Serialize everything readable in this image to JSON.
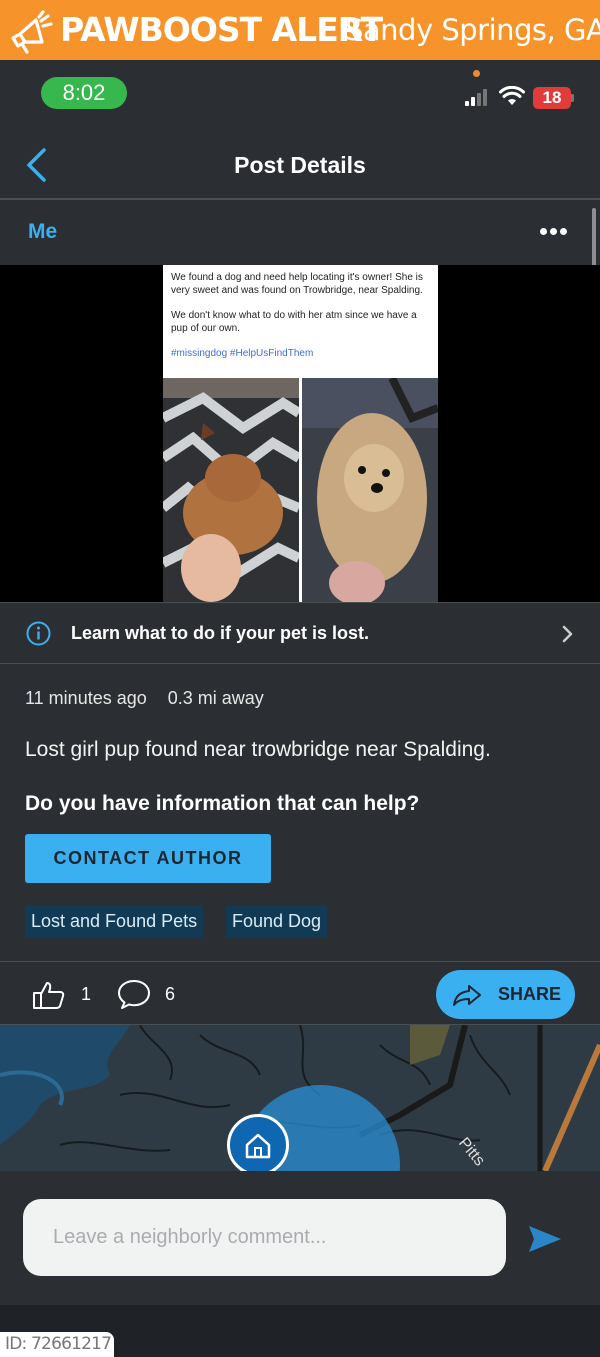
{
  "banner": {
    "title": "PAWBOOST ALERT",
    "location": "Sandy Springs, GA",
    "icon": "megaphone-icon",
    "color": "#f7932b"
  },
  "status_bar": {
    "time": "8:02",
    "battery": "18"
  },
  "header": {
    "title": "Post Details",
    "back_icon": "chevron-left-icon"
  },
  "author": {
    "name": "Me",
    "menu_icon": "more-horizontal-icon"
  },
  "post_image": {
    "text_line1": "We found a dog and need help locating it's owner! She is very sweet and was found on Trowbridge, near Spalding.",
    "text_line2": "We don't know what to do with her atm since we have a pup of our own.",
    "hashtags": "#missingdog #HelpUsFindThem"
  },
  "learn_banner": {
    "text": "Learn what to do if your pet is lost.",
    "icon": "info-icon"
  },
  "post": {
    "time_ago": "11 minutes ago",
    "distance": "0.3 mi away",
    "body": "Lost girl pup found near trowbridge near Spalding.",
    "help_question": "Do you have information that can help?",
    "contact_label": "CONTACT AUTHOR"
  },
  "tags": [
    "Lost and Found Pets",
    "Found Dog"
  ],
  "actions": {
    "likes": "1",
    "comments": "6",
    "share_label": "SHARE"
  },
  "map": {
    "road_label": "Pitts"
  },
  "comment": {
    "placeholder": "Leave a neighborly comment..."
  },
  "footer": {
    "id_text": "ID: 72661217"
  },
  "colors": {
    "accent": "#3ab0f0",
    "background": "#2b2f33",
    "tag_bg": "#123a55"
  }
}
